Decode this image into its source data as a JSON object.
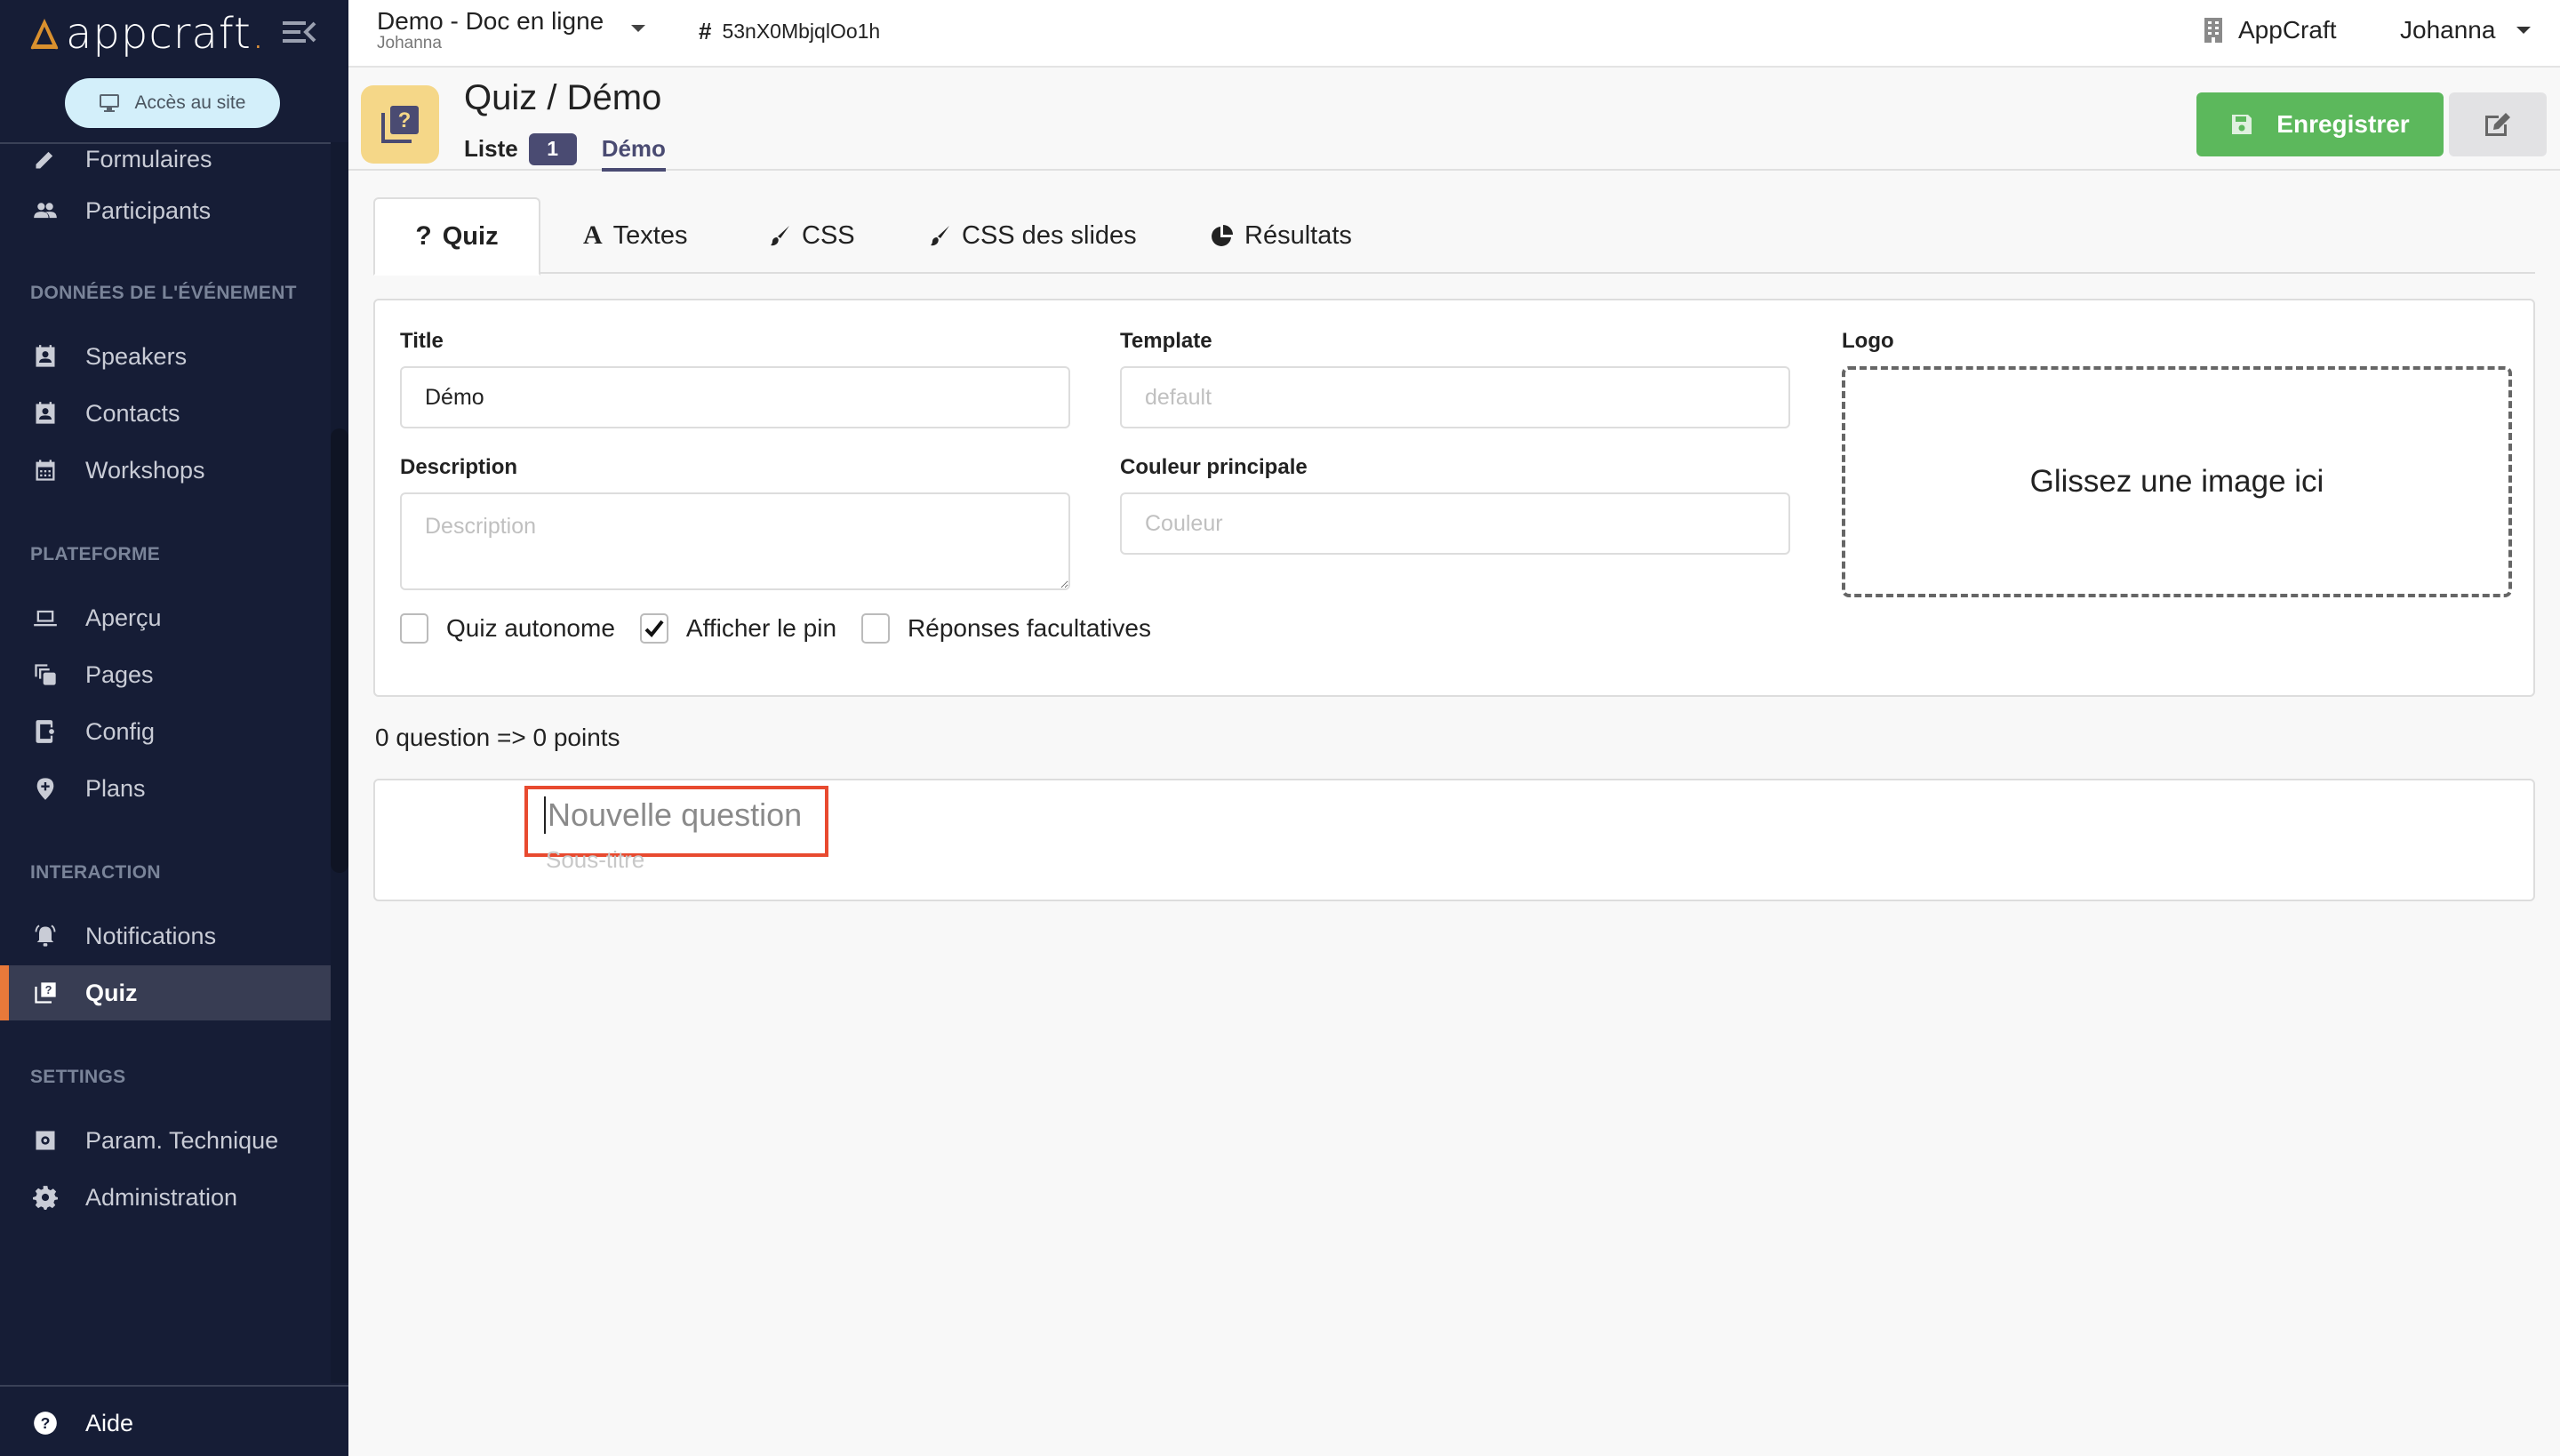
{
  "sidebar": {
    "brand": "appcraft",
    "brand_dot": ".",
    "site_button": "Accès au site",
    "partial_item": "Formulaires",
    "items_top": [
      {
        "label": "Participants",
        "icon": "people-icon"
      }
    ],
    "sections": [
      {
        "title": "DONNÉES DE L'ÉVÉNEMENT",
        "items": [
          {
            "label": "Speakers",
            "icon": "contact-card-icon"
          },
          {
            "label": "Contacts",
            "icon": "contact-card-icon"
          },
          {
            "label": "Workshops",
            "icon": "calendar-icon"
          }
        ]
      },
      {
        "title": "PLATEFORME",
        "items": [
          {
            "label": "Aperçu",
            "icon": "laptop-icon"
          },
          {
            "label": "Pages",
            "icon": "pages-icon"
          },
          {
            "label": "Config",
            "icon": "phone-settings-icon"
          },
          {
            "label": "Plans",
            "icon": "map-pin-plus-icon"
          }
        ]
      },
      {
        "title": "INTERACTION",
        "items": [
          {
            "label": "Notifications",
            "icon": "bell-ring-icon"
          },
          {
            "label": "Quiz",
            "icon": "quiz-icon",
            "active": true
          }
        ]
      },
      {
        "title": "SETTINGS",
        "items": [
          {
            "label": "Param. Technique",
            "icon": "settings-box-icon"
          },
          {
            "label": "Administration",
            "icon": "gear-icon"
          }
        ]
      }
    ],
    "footer": {
      "label": "Aide",
      "icon": "help-circle-icon"
    }
  },
  "topbar": {
    "project_name": "Demo - Doc en ligne",
    "project_owner": "Johanna",
    "project_id": "53nX0MbjqlOo1h",
    "organization": "AppCraft",
    "user": "Johanna"
  },
  "header": {
    "title": "Quiz / Démo",
    "list_label": "Liste",
    "list_count": "1",
    "current": "Démo",
    "save_label": "Enregistrer"
  },
  "tabs": [
    {
      "label": "Quiz",
      "icon": "question-icon",
      "active": true
    },
    {
      "label": "Textes",
      "icon": "font-icon"
    },
    {
      "label": "CSS",
      "icon": "paint-brush-icon"
    },
    {
      "label": "CSS des slides",
      "icon": "paint-brush-icon"
    },
    {
      "label": "Résultats",
      "icon": "pie-chart-icon"
    }
  ],
  "form": {
    "title_label": "Title",
    "title_value": "Démo",
    "template_label": "Template",
    "template_placeholder": "default",
    "description_label": "Description",
    "description_placeholder": "Description",
    "color_label": "Couleur principale",
    "color_placeholder": "Couleur",
    "logo_label": "Logo",
    "dropzone_text": "Glissez une image ici",
    "checkboxes": [
      {
        "label": "Quiz autonome",
        "checked": false
      },
      {
        "label": "Afficher le pin",
        "checked": true
      },
      {
        "label": "Réponses facultatives",
        "checked": false
      }
    ]
  },
  "stats": "0 question => 0 points",
  "question": {
    "title_placeholder": "Nouvelle question",
    "subtitle_placeholder": "Sous-titre"
  },
  "colors": {
    "sidebar_bg": "#161d36",
    "accent_orange": "#e8793a",
    "save_green": "#5cb85c",
    "badge_purple": "#4a4b72",
    "tile_yellow": "#f5d788",
    "highlight_red": "#e84a2f"
  }
}
